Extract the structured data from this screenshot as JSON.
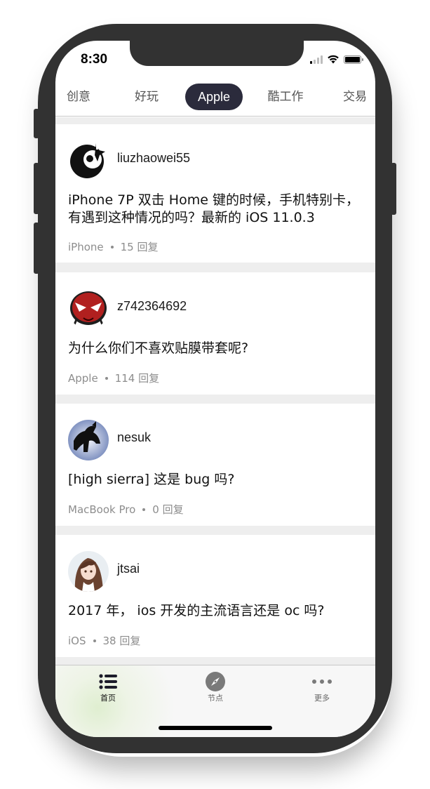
{
  "status_bar": {
    "time": "8:30",
    "signal_icon": "cellular-signal-icon",
    "wifi_icon": "wifi-icon",
    "battery_icon": "battery-icon"
  },
  "tabs": [
    {
      "label": "创意"
    },
    {
      "label": "好玩"
    },
    {
      "label": "Apple",
      "active": true
    },
    {
      "label": "酷工作"
    },
    {
      "label": "交易"
    }
  ],
  "posts": [
    {
      "username": "liuzhaowei55",
      "title": "iPhone 7P 双击 Home 键的时候，手机特别卡，有遇到这种情况的吗？最新的 iOS 11.0.3",
      "node": "iPhone",
      "replies": "15 回复",
      "avatar_icon": "ninja-avatar-icon"
    },
    {
      "username": "z742364692",
      "title": "为什么你们不喜欢贴膜带套呢?",
      "node": "Apple",
      "replies": "114 回复",
      "avatar_icon": "red-mask-avatar-icon"
    },
    {
      "username": "nesuk",
      "title": "[high sierra] 这是 bug 吗?",
      "node": "MacBook Pro",
      "replies": "0 回复",
      "avatar_icon": "silhouette-avatar-icon"
    },
    {
      "username": "jtsai",
      "title": "2017 年， ios 开发的主流语言还是 oc 吗?",
      "node": "iOS",
      "replies": "38 回复",
      "avatar_icon": "anime-girl-avatar-icon"
    }
  ],
  "bottom_tabs": [
    {
      "label": "首页",
      "icon": "list-icon",
      "active": true
    },
    {
      "label": "节点",
      "icon": "compass-icon"
    },
    {
      "label": "更多",
      "icon": "more-dots-icon"
    }
  ],
  "colors": {
    "frame": "#323232",
    "active_tab_bg": "#2b2b3c",
    "feed_bg": "#eeeeee",
    "meta_text": "#8d8d8d"
  }
}
